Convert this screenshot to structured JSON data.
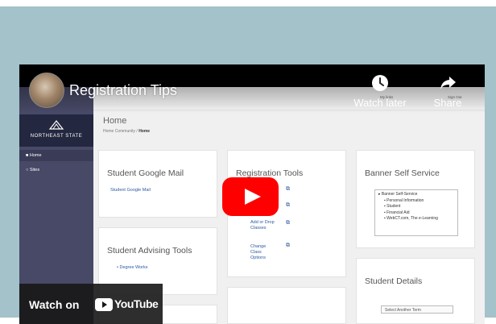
{
  "video": {
    "title": "Registration Tips",
    "watch_later_label": "Watch later",
    "share_label": "Share",
    "watch_on_label": "Watch on",
    "youtube_label": "YouTube"
  },
  "portal": {
    "logo_text": "NORTHEAST STATE",
    "sidebar": {
      "items": [
        {
          "label": "Home"
        },
        {
          "label": "Sites"
        }
      ]
    },
    "topbar": {
      "my_links": "My links",
      "sign_out": "Sign Out"
    },
    "page_title": "Home",
    "breadcrumb": {
      "parent": "Home Community",
      "current": "Home"
    },
    "panels": {
      "google_mail": {
        "title": "Student Google Mail",
        "link": "Student Google Mail"
      },
      "registration_tools": {
        "title": "Registration Tools",
        "links": [
          "Add or Drop Classes",
          "Change Class Options"
        ]
      },
      "banner": {
        "title": "Banner Self Service",
        "tree": [
          "Banner Self-Service",
          "Personal Information",
          "Student",
          "Financial Aid",
          "WebCT.com, The e-Learning"
        ]
      },
      "advising": {
        "title": "Student Advising Tools",
        "link": "Degree Works"
      },
      "details": {
        "title": "Student Details",
        "select_placeholder": "Select Another Term"
      }
    }
  }
}
